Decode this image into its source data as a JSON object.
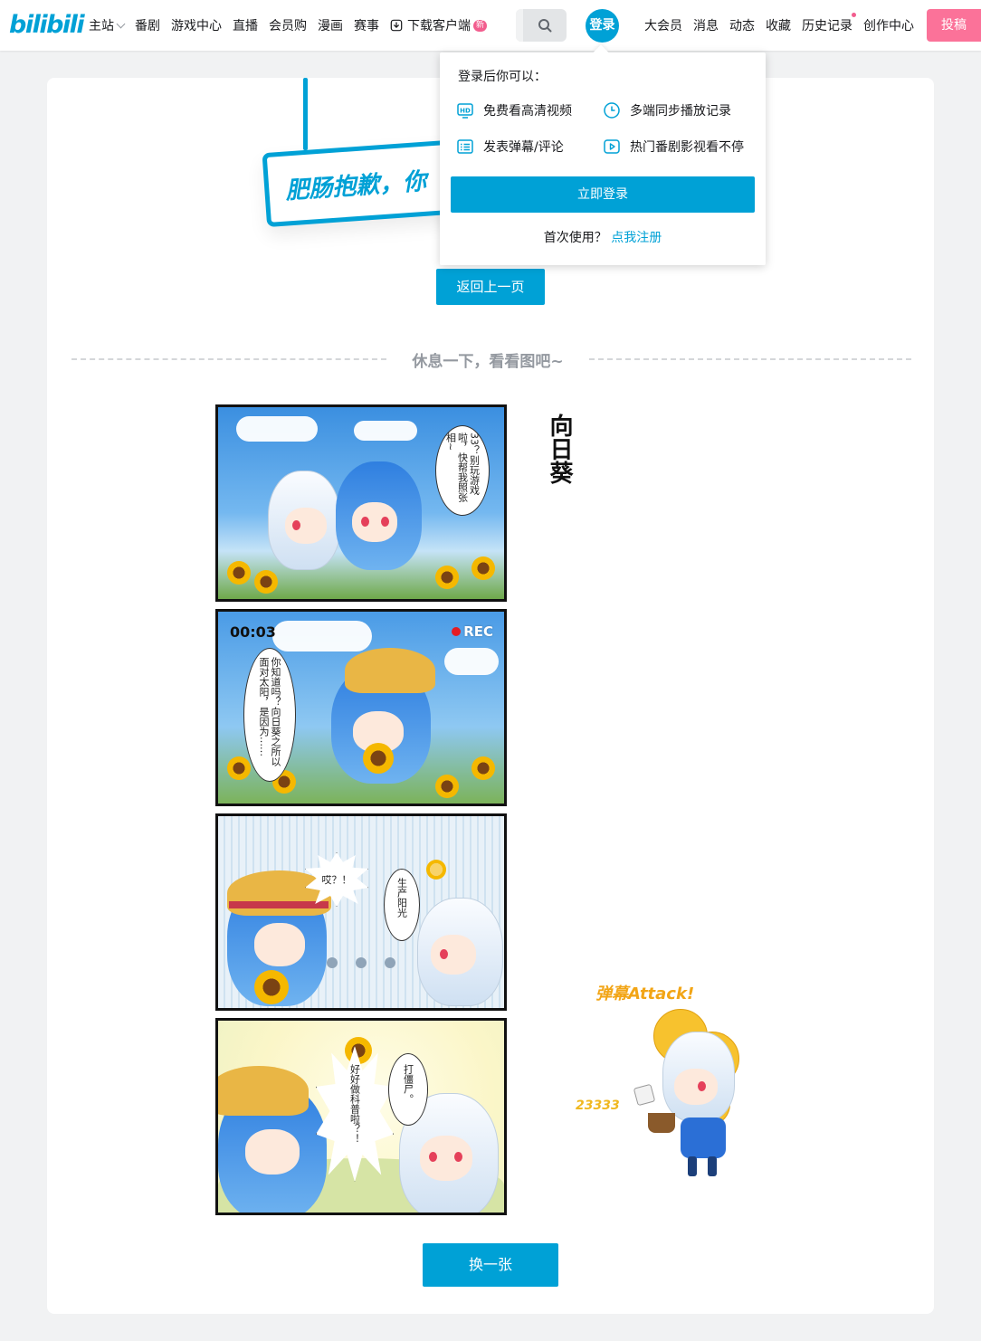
{
  "header": {
    "logo_text": "bilibili",
    "nav_left": [
      {
        "label": "主站"
      },
      {
        "label": "番剧"
      },
      {
        "label": "游戏中心"
      },
      {
        "label": "直播"
      },
      {
        "label": "会员购"
      },
      {
        "label": "漫画"
      },
      {
        "label": "赛事"
      },
      {
        "label": "下载客户端"
      }
    ],
    "new_badge": "新",
    "login_label": "登录",
    "nav_right": [
      {
        "label": "大会员"
      },
      {
        "label": "消息"
      },
      {
        "label": "动态"
      },
      {
        "label": "收藏"
      },
      {
        "label": "历史记录"
      },
      {
        "label": "创作中心"
      }
    ],
    "upload_label": "投稿",
    "accent_color": "#00a1d6",
    "pink_color": "#fb7299"
  },
  "popup": {
    "title": "登录后你可以：",
    "features": [
      {
        "icon": "hd-icon",
        "label": "免费看高清视频"
      },
      {
        "icon": "clock-icon",
        "label": "多端同步播放记录"
      },
      {
        "icon": "danmaku-icon",
        "label": "发表弹幕/评论"
      },
      {
        "icon": "play-icon",
        "label": "热门番剧影视看不停"
      }
    ],
    "login_button": "立即登录",
    "register_prompt": "首次使用？",
    "register_link": "点我注册"
  },
  "main": {
    "sign_text": "肥肠抱歉，你",
    "back_button": "返回上一页",
    "divider_text": "休息一下，看看图吧~",
    "comic_title": "向日葵",
    "panels": [
      {
        "speech": "33？别玩游戏啦，快帮我照张相~"
      },
      {
        "timer": "00:03",
        "rec": "REC",
        "speech": "你知道吗？向日葵之所以面对太阳，是因为……"
      },
      {
        "speech_a": "哎？！",
        "speech_b": "生产阳光"
      },
      {
        "speech_a": "好好做科普啦？！",
        "speech_b": "打僵尸。"
      }
    ],
    "attack_text": "弹幕Attack!",
    "counter_text": "23333",
    "change_button": "换一张"
  }
}
